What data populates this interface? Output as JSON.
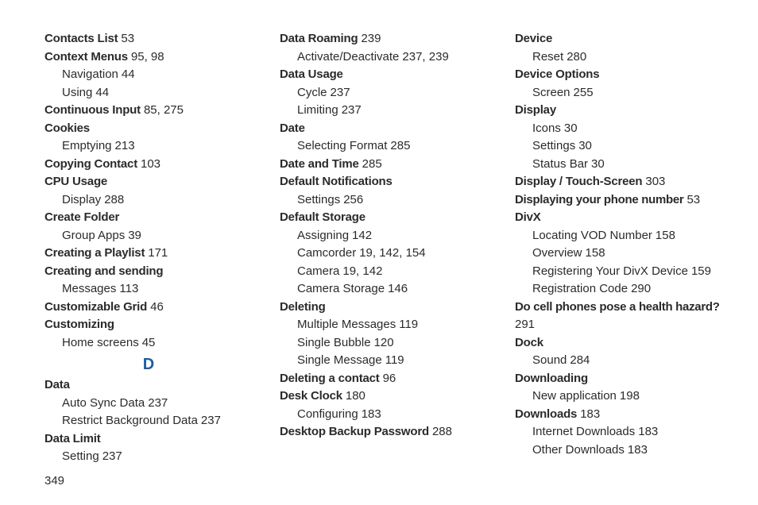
{
  "letter": "D",
  "pageNumber": "349",
  "col1": {
    "contactsList": {
      "t": "Contacts List",
      "p": "53"
    },
    "contextMenus": {
      "t": "Context Menus",
      "p": "95, 98"
    },
    "contextMenus_nav": {
      "t": "Navigation",
      "p": "44"
    },
    "contextMenus_using": {
      "t": "Using",
      "p": "44"
    },
    "continuousInput": {
      "t": "Continuous Input",
      "p": "85, 275"
    },
    "cookies": {
      "t": "Cookies"
    },
    "cookies_empty": {
      "t": "Emptying",
      "p": "213"
    },
    "copyingContact": {
      "t": "Copying Contact",
      "p": "103"
    },
    "cpuUsage": {
      "t": "CPU Usage"
    },
    "cpuUsage_display": {
      "t": "Display",
      "p": "288"
    },
    "createFolder": {
      "t": "Create Folder"
    },
    "createFolder_group": {
      "t": "Group Apps",
      "p": "39"
    },
    "creatingPlaylist": {
      "t": "Creating a Playlist",
      "p": "171"
    },
    "creatingSending": {
      "t": "Creating and sending"
    },
    "creatingSending_msgs": {
      "t": "Messages",
      "p": "113"
    },
    "customGrid": {
      "t": "Customizable Grid",
      "p": "46"
    },
    "customizing": {
      "t": "Customizing"
    },
    "customizing_home": {
      "t": "Home screens",
      "p": "45"
    },
    "data": {
      "t": "Data"
    },
    "data_autoSync": {
      "t": "Auto Sync Data",
      "p": "237"
    },
    "data_restrict": {
      "t": "Restrict Background Data",
      "p": "237"
    },
    "dataLimit": {
      "t": "Data Limit"
    },
    "dataLimit_setting": {
      "t": "Setting",
      "p": "237"
    }
  },
  "col2": {
    "dataRoaming": {
      "t": "Data Roaming",
      "p": "239"
    },
    "dataRoaming_act": {
      "t": "Activate/Deactivate",
      "p": "237, 239"
    },
    "dataUsage": {
      "t": "Data Usage"
    },
    "dataUsage_cycle": {
      "t": "Cycle",
      "p": "237"
    },
    "dataUsage_limit": {
      "t": "Limiting",
      "p": "237"
    },
    "date": {
      "t": "Date"
    },
    "date_format": {
      "t": "Selecting Format",
      "p": "285"
    },
    "dateTime": {
      "t": "Date and Time",
      "p": "285"
    },
    "defaultNotif": {
      "t": "Default Notifications"
    },
    "defaultNotif_settings": {
      "t": "Settings",
      "p": "256"
    },
    "defaultStorage": {
      "t": "Default Storage"
    },
    "defaultStorage_assign": {
      "t": "Assigning",
      "p": "142"
    },
    "defaultStorage_camcord": {
      "t": "Camcorder",
      "p": "19, 142, 154"
    },
    "defaultStorage_camera": {
      "t": "Camera",
      "p": "19, 142"
    },
    "defaultStorage_camStor": {
      "t": "Camera Storage",
      "p": "146"
    },
    "deleting": {
      "t": "Deleting"
    },
    "deleting_multi": {
      "t": "Multiple Messages",
      "p": "119"
    },
    "deleting_bubble": {
      "t": "Single Bubble",
      "p": "120"
    },
    "deleting_single": {
      "t": "Single Message",
      "p": "119"
    },
    "deletingContact": {
      "t": "Deleting a contact",
      "p": "96"
    },
    "deskClock": {
      "t": "Desk Clock",
      "p": "180"
    },
    "deskClock_config": {
      "t": "Configuring",
      "p": "183"
    },
    "desktopBackup": {
      "t": "Desktop Backup Password",
      "p": "288"
    }
  },
  "col3": {
    "device": {
      "t": "Device"
    },
    "device_reset": {
      "t": "Reset",
      "p": "280"
    },
    "deviceOptions": {
      "t": "Device Options"
    },
    "deviceOptions_screen": {
      "t": "Screen",
      "p": "255"
    },
    "display": {
      "t": "Display"
    },
    "display_icons": {
      "t": "Icons",
      "p": "30"
    },
    "display_settings": {
      "t": "Settings",
      "p": "30"
    },
    "display_statusBar": {
      "t": "Status Bar",
      "p": "30"
    },
    "displayTouch": {
      "t": "Display / Touch-Screen",
      "p": "303"
    },
    "displayPhone": {
      "t": "Displaying your phone number",
      "p": "53"
    },
    "divx": {
      "t": "DivX"
    },
    "divx_vod": {
      "t": "Locating VOD Number",
      "p": "158"
    },
    "divx_overview": {
      "t": "Overview",
      "p": "158"
    },
    "divx_register": {
      "t": "Registering Your DivX Device",
      "p": "159"
    },
    "divx_regCode": {
      "t": "Registration Code",
      "p": "290"
    },
    "healthHazard": {
      "t": "Do cell phones pose a health hazard?"
    },
    "healthHazard_p": "291",
    "dock": {
      "t": "Dock"
    },
    "dock_sound": {
      "t": "Sound",
      "p": "284"
    },
    "downloading": {
      "t": "Downloading"
    },
    "downloading_new": {
      "t": "New application",
      "p": "198"
    },
    "downloads": {
      "t": "Downloads",
      "p": "183"
    },
    "downloads_internet": {
      "t": "Internet Downloads",
      "p": "183"
    },
    "downloads_other": {
      "t": "Other Downloads",
      "p": "183"
    }
  }
}
